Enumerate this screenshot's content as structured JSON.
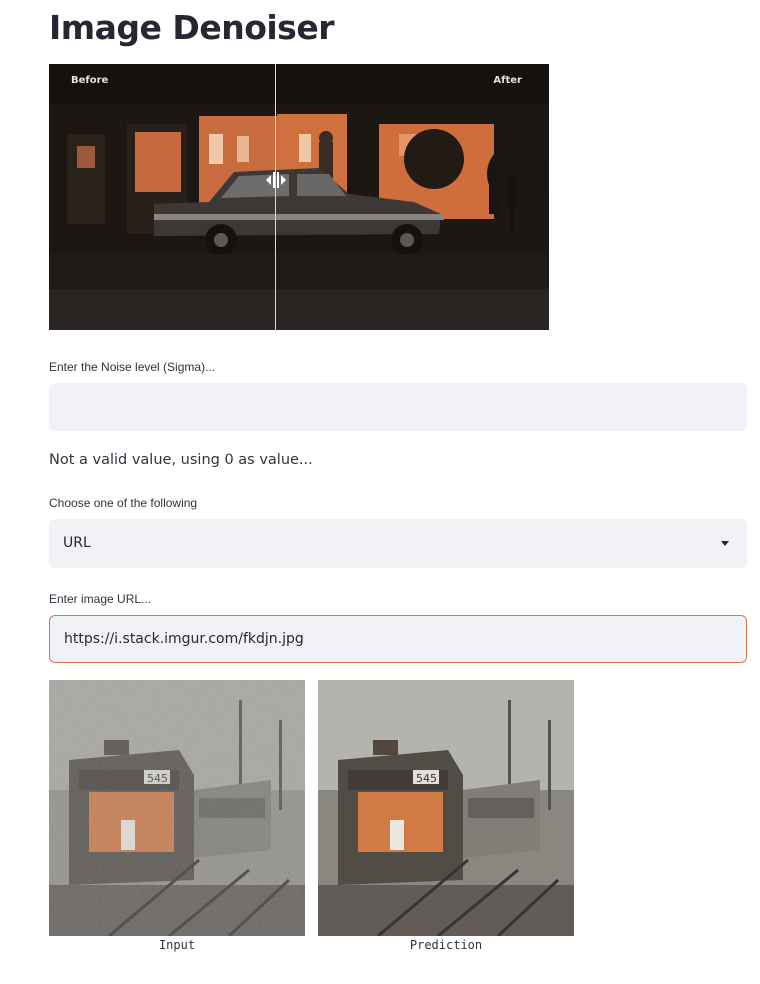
{
  "page": {
    "title": "Image Denoiser"
  },
  "comparison": {
    "before_label": "Before",
    "after_label": "After"
  },
  "noise_input": {
    "label": "Enter the Noise level (Sigma)...",
    "value": "",
    "placeholder": ""
  },
  "status": {
    "message": "Not a valid value, using 0 as value..."
  },
  "source_select": {
    "label": "Choose one of the following",
    "selected": "URL"
  },
  "url_input": {
    "label": "Enter image URL...",
    "value": "https://i.stack.imgur.com/fkdjn.jpg"
  },
  "results": {
    "input_caption": "Input",
    "prediction_caption": "Prediction"
  },
  "colors": {
    "accent": "#d9764c",
    "input_bg": "#f0f2f6",
    "text": "#262730"
  }
}
